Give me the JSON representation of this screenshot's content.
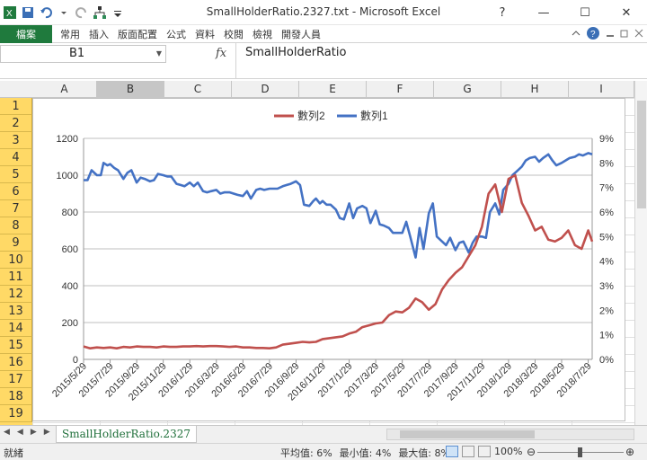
{
  "window": {
    "title": "SmallHolderRatio.2327.txt - Microsoft Excel"
  },
  "ribbon": {
    "file_tab": "檔案",
    "tabs": [
      "常用",
      "插入",
      "版面配置",
      "公式",
      "資料",
      "校閱",
      "檢視",
      "開發人員"
    ]
  },
  "formula_bar": {
    "name_box": "B1",
    "fx": "fx",
    "content": "SmallHolderRatio"
  },
  "columns": [
    "A",
    "B",
    "C",
    "D",
    "E",
    "F",
    "G",
    "H",
    "I"
  ],
  "rows": [
    "1",
    "2",
    "3",
    "4",
    "5",
    "6",
    "7",
    "8",
    "9",
    "10",
    "11",
    "12",
    "13",
    "14",
    "15",
    "16",
    "17",
    "18",
    "19"
  ],
  "sheet": {
    "tab_name": "SmallHolderRatio.2327"
  },
  "status": {
    "ready": "就緒",
    "average": "平均值: 6%",
    "min": "最小值: 4%",
    "max": "最大值: 8%",
    "zoom": "100%"
  },
  "colors": {
    "series1": "#4472c4",
    "series2": "#c0504d",
    "file_tab": "#1f7a3d",
    "row_header": "#ffd966"
  },
  "chart_data": {
    "type": "line",
    "legend": [
      "數列2",
      "數列1"
    ],
    "legend_position": "top",
    "x_ticks": [
      "2015/5/29",
      "2015/7/29",
      "2015/9/29",
      "2015/11/29",
      "2016/1/29",
      "2016/3/29",
      "2016/5/29",
      "2016/7/29",
      "2016/9/29",
      "2016/11/29",
      "2017/1/29",
      "2017/3/29",
      "2017/5/29",
      "2017/7/29",
      "2017/9/29",
      "2017/11/29",
      "2018/1/29",
      "2018/3/29",
      "2018/5/29",
      "2018/7/29"
    ],
    "y_left": {
      "ticks": [
        "0",
        "200",
        "400",
        "600",
        "800",
        "1000",
        "1200"
      ],
      "range": [
        0,
        1200
      ]
    },
    "y_right": {
      "ticks": [
        "0%",
        "1%",
        "2%",
        "3%",
        "4%",
        "5%",
        "6%",
        "7%",
        "8%",
        "9%"
      ],
      "range": [
        0,
        9
      ]
    },
    "grid": "horizontal",
    "series": [
      {
        "name": "數列1",
        "axis": "right",
        "color": "#4472c4",
        "x": [
          0,
          0.3,
          0.6,
          1,
          1.3,
          1.5,
          1.8,
          2,
          2.3,
          2.6,
          3,
          3.3,
          3.6,
          4,
          4.3,
          4.6,
          5,
          5.3,
          5.6,
          6,
          6.3,
          6.6,
          7,
          7.3,
          7.6,
          8,
          8.3,
          8.6,
          9,
          9.3,
          9.6,
          10,
          10.3,
          10.6,
          11,
          11.3,
          11.6,
          12,
          12.3,
          12.6,
          13,
          13.3,
          13.6,
          14,
          14.3,
          14.6,
          15,
          15.3,
          15.6,
          16,
          16.3,
          16.6,
          17,
          17.3,
          17.5,
          17.8,
          18,
          18.3,
          18.6,
          19,
          19.3,
          19.6,
          20,
          20.3,
          20.6,
          21,
          21.3,
          21.6,
          22,
          22.3,
          22.6,
          23,
          23.3,
          23.6,
          24,
          24.3,
          24.6,
          25,
          25.3,
          25.6,
          26,
          26.3,
          26.6,
          27,
          27.3,
          27.6,
          28,
          28.3,
          28.6,
          29,
          29.3,
          29.6,
          30,
          30.3,
          30.6,
          31,
          31.3,
          31.6,
          32,
          32.3,
          32.6,
          33,
          33.3,
          33.6,
          34,
          34.3,
          34.6,
          35,
          35.3,
          35.6,
          36,
          36.3,
          36.6,
          37,
          37.3,
          37.6,
          38,
          38.3
        ],
        "y": [
          7.3,
          7.3,
          7.7,
          7.5,
          7.5,
          8.0,
          7.9,
          7.95,
          7.8,
          7.7,
          7.35,
          7.6,
          7.7,
          7.2,
          7.4,
          7.35,
          7.25,
          7.3,
          7.55,
          7.5,
          7.45,
          7.45,
          7.15,
          7.1,
          7.05,
          7.2,
          7.05,
          7.2,
          6.85,
          6.8,
          6.85,
          6.9,
          6.75,
          6.8,
          6.8,
          6.75,
          6.7,
          6.65,
          6.85,
          6.55,
          6.9,
          6.95,
          6.9,
          6.95,
          6.95,
          6.95,
          7.05,
          7.1,
          7.15,
          7.25,
          7.1,
          6.3,
          6.25,
          6.45,
          6.55,
          6.35,
          6.45,
          6.3,
          6.3,
          6.1,
          5.75,
          5.7,
          6.35,
          5.75,
          6.15,
          6.25,
          6.15,
          5.55,
          6.05,
          5.5,
          5.45,
          5.35,
          5.15,
          5.15,
          5.15,
          5.6,
          5.0,
          4.15,
          5.35,
          4.5,
          5.95,
          6.35,
          5.0,
          4.8,
          4.65,
          4.95,
          4.45,
          4.75,
          4.8,
          4.35,
          4.75,
          5.0,
          5.0,
          4.95,
          6.0,
          6.35,
          5.9,
          6.9,
          7.15,
          7.5,
          7.65,
          7.85,
          8.1,
          8.2,
          8.25,
          8.05,
          8.2,
          8.35,
          8.1,
          7.9,
          8.0,
          8.1,
          8.2,
          8.25,
          8.35,
          8.3,
          8.4,
          8.35
        ],
        "note": ""
      },
      {
        "name": "數列2",
        "axis": "left",
        "color": "#c0504d",
        "x": [
          0,
          0.5,
          1,
          1.5,
          2,
          2.5,
          3,
          3.5,
          4,
          4.5,
          5,
          5.5,
          6,
          6.5,
          7,
          7.5,
          8,
          8.5,
          9,
          9.5,
          10,
          10.5,
          11,
          11.5,
          12,
          12.5,
          13,
          13.5,
          14,
          14.5,
          15,
          15.5,
          16,
          16.5,
          17,
          17.5,
          18,
          18.5,
          19,
          19.5,
          20,
          20.5,
          21,
          21.5,
          22,
          22.5,
          23,
          23.5,
          24,
          24.5,
          25,
          25.5,
          26,
          26.5,
          27,
          27.5,
          28,
          28.5,
          29,
          29.5,
          30,
          30.5,
          31,
          31.5,
          32,
          32.5,
          33,
          33.5,
          34,
          34.5,
          35,
          35.5,
          36,
          36.5,
          37,
          37.5,
          38,
          38.3
        ],
        "y": [
          70,
          60,
          65,
          62,
          65,
          60,
          68,
          65,
          70,
          68,
          68,
          65,
          70,
          68,
          68,
          70,
          70,
          72,
          70,
          72,
          72,
          70,
          68,
          70,
          65,
          65,
          62,
          62,
          60,
          65,
          80,
          85,
          90,
          95,
          92,
          95,
          110,
          115,
          120,
          125,
          140,
          150,
          175,
          185,
          195,
          200,
          240,
          260,
          255,
          280,
          330,
          310,
          270,
          300,
          380,
          430,
          470,
          500,
          560,
          620,
          720,
          900,
          950,
          800,
          980,
          1000,
          850,
          780,
          700,
          720,
          650,
          640,
          660,
          700,
          620,
          600,
          700,
          640
        ],
        "note": ""
      }
    ]
  }
}
